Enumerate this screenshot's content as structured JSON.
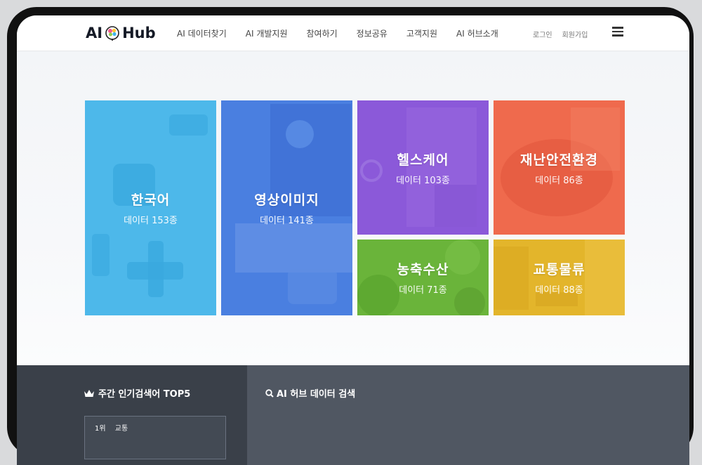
{
  "header": {
    "logo_left": "AI",
    "logo_right": "Hub",
    "nav": [
      "AI 데이터찾기",
      "AI 개발지원",
      "참여하기",
      "정보공유",
      "고객지원",
      "AI 허브소개"
    ],
    "login": "로그인",
    "signup": "회원가입"
  },
  "categories": [
    {
      "title": "한국어",
      "count": "데이터 153종",
      "color": "#4db8ea"
    },
    {
      "title": "영상이미지",
      "count": "데이터 141종",
      "color": "#4a7fe0"
    },
    {
      "title": "헬스케어",
      "count": "데이터 103종",
      "color": "#8b59d9"
    },
    {
      "title": "재난안전환경",
      "count": "데이터 86종",
      "color": "#ef6a4d"
    },
    {
      "title": "농축수산",
      "count": "데이터 71종",
      "color": "#6ab43a"
    },
    {
      "title": "교통물류",
      "count": "데이터 88종",
      "color": "#e3b52b"
    }
  ],
  "popular": {
    "title": "주간 인기검색어 TOP5",
    "items": [
      {
        "rank": "1위",
        "term": "교통"
      }
    ]
  },
  "search": {
    "title": "AI 허브 데이터 검색"
  },
  "colors": {
    "bottom_left": "#3a4049",
    "bottom_right": "#505762",
    "header_text": "#151a26"
  }
}
